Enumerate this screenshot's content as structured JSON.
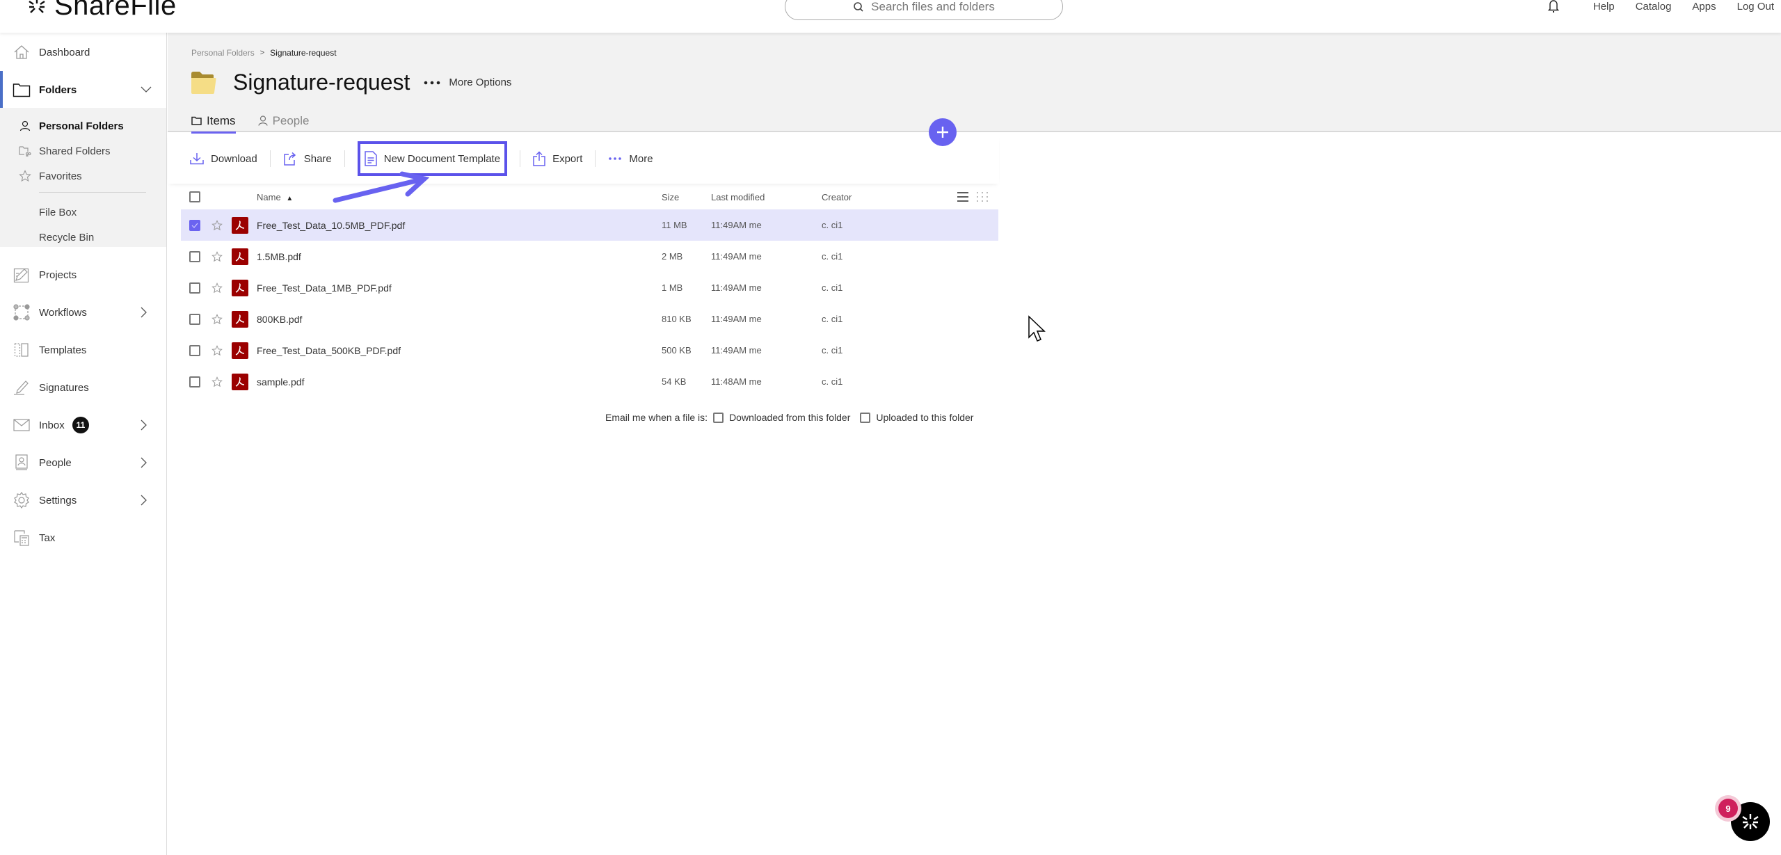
{
  "app": {
    "name": "ShareFile"
  },
  "header": {
    "search_placeholder": "Search files and folders",
    "links": [
      "Help",
      "Catalog",
      "Apps",
      "Log Out"
    ]
  },
  "sidebar": {
    "dashboard": "Dashboard",
    "folders": "Folders",
    "folder_items": [
      {
        "label": "Personal Folders",
        "icon": "person-icon",
        "active": true
      },
      {
        "label": "Shared Folders",
        "icon": "shared-folder-icon",
        "active": false
      },
      {
        "label": "Favorites",
        "icon": "star-icon",
        "active": false
      }
    ],
    "folder_extra": [
      "File Box",
      "Recycle Bin"
    ],
    "items": [
      {
        "label": "Projects",
        "icon": "projects-icon"
      },
      {
        "label": "Workflows",
        "icon": "workflows-icon",
        "has_chevron": true
      },
      {
        "label": "Templates",
        "icon": "templates-icon"
      },
      {
        "label": "Signatures",
        "icon": "signature-icon"
      },
      {
        "label": "Inbox",
        "icon": "mail-icon",
        "has_chevron": true,
        "badge": "11"
      },
      {
        "label": "People",
        "icon": "contacts-icon",
        "has_chevron": true
      },
      {
        "label": "Settings",
        "icon": "gear-icon",
        "has_chevron": true
      },
      {
        "label": "Tax",
        "icon": "tax-icon"
      }
    ]
  },
  "breadcrumb": {
    "parent": "Personal Folders",
    "separator": ">",
    "current": "Signature-request"
  },
  "folder": {
    "title": "Signature-request",
    "more_options": "More Options"
  },
  "tabs": [
    {
      "label": "Items",
      "active": true
    },
    {
      "label": "People",
      "active": false
    }
  ],
  "toolbar": {
    "download": "Download",
    "share": "Share",
    "new_document_template": "New Document Template",
    "export": "Export",
    "more": "More"
  },
  "table": {
    "columns": {
      "name": "Name",
      "name_sort": "▲",
      "size": "Size",
      "modified": "Last modified",
      "creator": "Creator"
    },
    "rows": [
      {
        "name": "Free_Test_Data_10.5MB_PDF.pdf",
        "size": "11 MB",
        "modified": "11:49AM me",
        "creator": "c. ci1",
        "selected": true
      },
      {
        "name": "1.5MB.pdf",
        "size": "2 MB",
        "modified": "11:49AM me",
        "creator": "c. ci1",
        "selected": false
      },
      {
        "name": "Free_Test_Data_1MB_PDF.pdf",
        "size": "1 MB",
        "modified": "11:49AM me",
        "creator": "c. ci1",
        "selected": false
      },
      {
        "name": "800KB.pdf",
        "size": "810 KB",
        "modified": "11:49AM me",
        "creator": "c. ci1",
        "selected": false
      },
      {
        "name": "Free_Test_Data_500KB_PDF.pdf",
        "size": "500 KB",
        "modified": "11:49AM me",
        "creator": "c. ci1",
        "selected": false
      },
      {
        "name": "sample.pdf",
        "size": "54 KB",
        "modified": "11:48AM me",
        "creator": "c. ci1",
        "selected": false
      }
    ]
  },
  "email_notify": {
    "label": "Email me when a file is:",
    "downloaded": "Downloaded from this folder",
    "uploaded": "Uploaded to this folder"
  },
  "assistant": {
    "badge_count": "9"
  },
  "colors": {
    "accent": "#6862f0",
    "highlight_box": "#5b52ea",
    "selected_row": "#e5e5fb",
    "pdf_red": "#9b0000",
    "nav_active_bar": "#4a6fc7",
    "assistant_badge": "#cf1f5c"
  }
}
